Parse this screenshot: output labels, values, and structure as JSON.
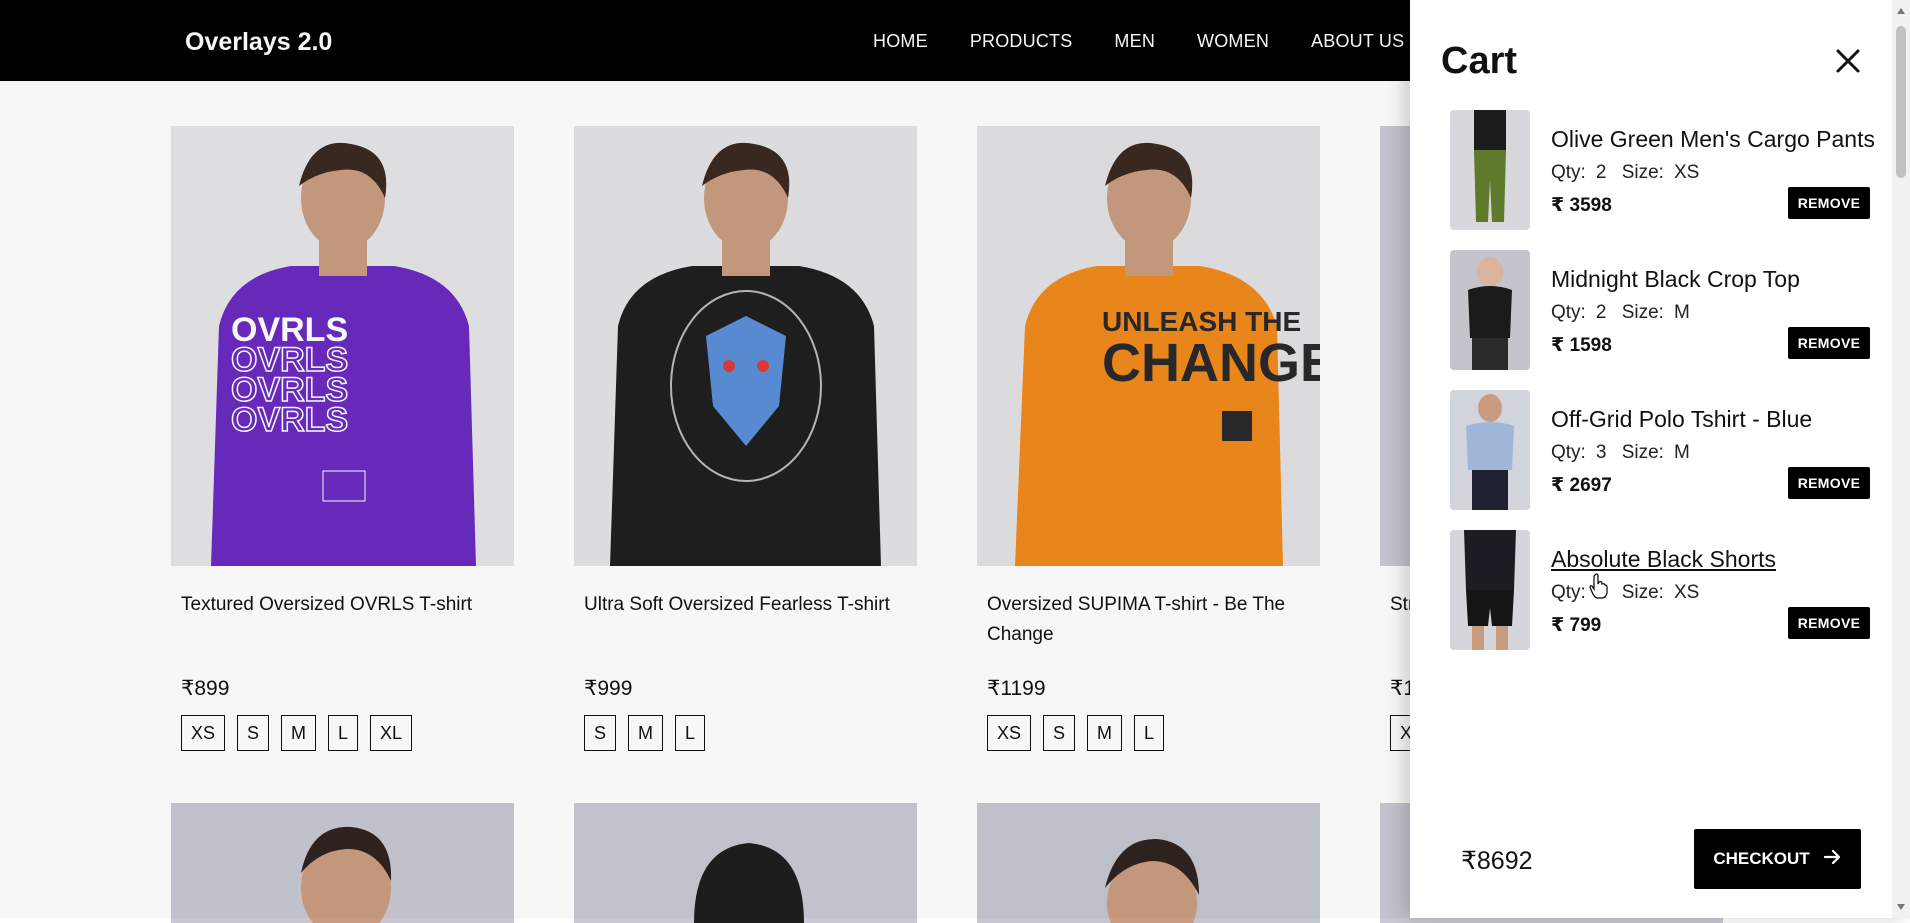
{
  "header": {
    "brand": "Overlays 2.0",
    "nav": [
      "HOME",
      "PRODUCTS",
      "MEN",
      "WOMEN",
      "ABOUT US"
    ]
  },
  "products": [
    {
      "name": "Textured Oversized OVRLS T-shirt",
      "price": "₹899",
      "sizes": [
        "XS",
        "S",
        "M",
        "L",
        "XL"
      ],
      "shirt_color": "#6a2bbf",
      "print": "OVRLS"
    },
    {
      "name": "Ultra Soft Oversized Fearless T-shirt",
      "price": "₹999",
      "sizes": [
        "S",
        "M",
        "L"
      ],
      "shirt_color": "#1f1f1f",
      "print": ""
    },
    {
      "name": "Oversized SUPIMA T-shirt - Be The Change",
      "price": "₹1199",
      "sizes": [
        "XS",
        "S",
        "M",
        "L"
      ],
      "shirt_color": "#f08a1c",
      "print": "UNLEASH THE CHANGE"
    },
    {
      "name": "Str",
      "price": "₹1",
      "sizes": [
        "X"
      ],
      "shirt_color": "#c9cad4",
      "print": ""
    }
  ],
  "cart": {
    "title": "Cart",
    "qty_label": "Qty:",
    "size_label": "Size:",
    "remove_label": "REMOVE",
    "items": [
      {
        "name": "Olive Green Men's Cargo Pants",
        "qty": "2",
        "size": "XS",
        "price": "₹ 3598",
        "color": "#5e7a2a"
      },
      {
        "name": "Midnight Black Crop Top",
        "qty": "2",
        "size": "M",
        "price": "₹ 1598",
        "color": "#1b1b1b"
      },
      {
        "name": "Off-Grid Polo Tshirt - Blue",
        "qty": "3",
        "size": "M",
        "price": "₹ 2697",
        "color": "#9fb6d8"
      },
      {
        "name": "Absolute Black Shorts",
        "qty": "1",
        "size": "XS",
        "price": "₹ 799",
        "color": "#151515"
      }
    ],
    "total": "₹8692",
    "checkout_label": "CHECKOUT"
  }
}
